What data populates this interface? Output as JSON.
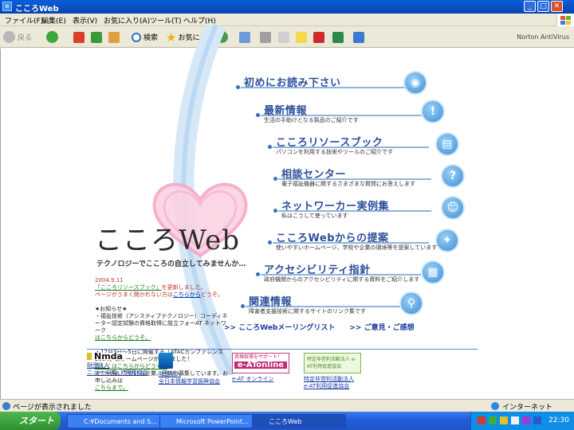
{
  "window": {
    "title": "こころWeb"
  },
  "menu": [
    "ファイル(F)",
    "編集(E)",
    "表示(V)",
    "お気に入り(A)",
    "ツール(T)",
    "ヘルプ(H)"
  ],
  "toolbar": {
    "back": "戻る",
    "search": "検索",
    "favorites": "お気に入り",
    "norton": "Norton AntiVirus"
  },
  "site": {
    "logo": "こころWeb",
    "tagline": "テクノロジーでこころの自立してみませんか…",
    "news": {
      "date": "2004.9.11",
      "line1a": "「こころリソースブック」",
      "line1b": "を更新しました。",
      "line2a": "ページがうまく開かれない方は",
      "line2b": "こちらから",
      "line2c": "どうぞ。",
      "block2_title": "★お知らせ★",
      "block2_body": "・福祉技術（アシスティブテクノロジー）コーディネーター認定試験の資格取得に設立フォーAT ネットワーク",
      "block2_link": "はこちらからどうぞ。",
      "block3_body": "・12月3日～5日に開催する「ATACカンファレンス2004」のホームページができました！",
      "block3_link1": "詳しくはこちらからどうぞ。",
      "block3_body2": "また出展いただける企業、団体を募集しています。お申し込みは",
      "block3_link2": "こちらまで。"
    },
    "entries": [
      {
        "label": "初めにお読み下さい",
        "desc": ""
      },
      {
        "label": "最新情報",
        "desc": "生活の手助けとなる製品のご紹介です"
      },
      {
        "label": "こころリソースブック",
        "desc": "パソコンを利用する技術やツールのご紹介です"
      },
      {
        "label": "相談センター",
        "desc": "電子福祉機器に関するさまざまな質問にお答えします"
      },
      {
        "label": "ネットワーカー実例集",
        "desc": "私はこうして使っています"
      },
      {
        "label": "こころWebからの提案",
        "desc": "使いやすいホームページ、学校や企業の環境等を提案しています"
      },
      {
        "label": "アクセシビリティ指針",
        "desc": "政府機関からのアクセシビリティに関する資料をご紹介します"
      },
      {
        "label": "関連情報",
        "desc": "障害者支援技術に関するサイトのリンク集です"
      }
    ],
    "badges": [
      "◉",
      "!",
      "▤",
      "?",
      "☺",
      "✦",
      "▦",
      "⚲"
    ],
    "links": [
      ">> こころWebメーリングリスト",
      ">> ご意見・ご感想"
    ],
    "orgs": [
      {
        "mark": "Nmda",
        "line1": "財団法人",
        "line2": "ニューメディア開発協会"
      },
      {
        "mark": "",
        "line1": "財団法人",
        "line2": "全日本情報学習振興協会"
      },
      {
        "mark": "e-ATonline",
        "line1": "e-AT オンライン",
        "line2": "",
        "badge": "資格取得をサポート！"
      },
      {
        "mark": "特定非営利活動法人 e-AT利用促進協会",
        "line1": "特定非営利活動法人",
        "line2": "e-AT利用促進協会"
      }
    ]
  },
  "status": {
    "text": "ページが表示されました",
    "zone": "インターネット"
  },
  "taskbar": {
    "start": "スタート",
    "tasks": [
      "C:¥Documents and S...",
      "Microsoft PowerPoint...",
      "こころWeb"
    ],
    "clock": "22:30"
  },
  "colors": {
    "title_bar": "#0842b0",
    "entry_label": "#2c4f9a",
    "arc": "#cfe4f7",
    "heart": "#f4a8c8"
  }
}
